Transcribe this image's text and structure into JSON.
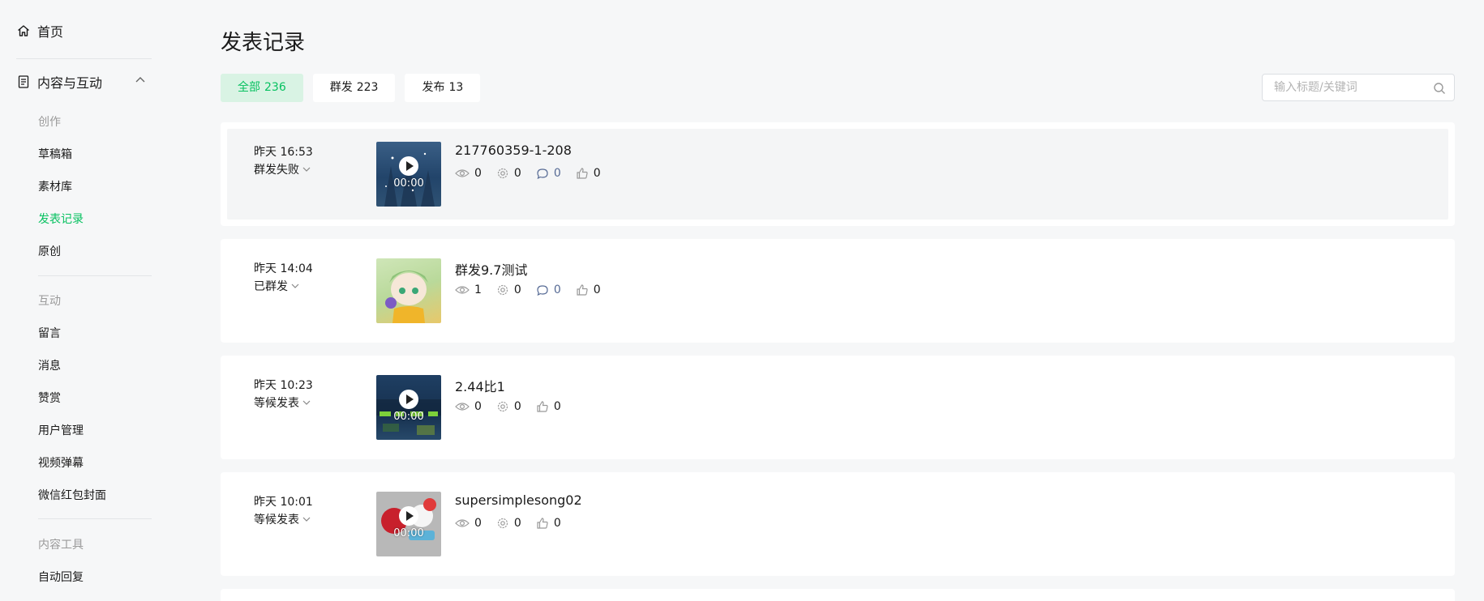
{
  "sidebar": {
    "home_label": "首页",
    "section_label": "内容与互动",
    "groups": [
      {
        "label": "创作",
        "items": [
          "草稿箱",
          "素材库",
          "发表记录",
          "原创"
        ]
      },
      {
        "label": "互动",
        "items": [
          "留言",
          "消息",
          "赞赏",
          "用户管理",
          "视频弹幕",
          "微信红包封面"
        ]
      },
      {
        "label": "内容工具",
        "items": [
          "自动回复"
        ]
      }
    ],
    "active_item": "发表记录"
  },
  "page": {
    "title": "发表记录",
    "tabs": [
      {
        "label": "全部",
        "count": "236"
      },
      {
        "label": "群发",
        "count": "223"
      },
      {
        "label": "发布",
        "count": "13"
      }
    ],
    "search_placeholder": "输入标题/关键词"
  },
  "records": [
    {
      "time": "昨天 16:53",
      "status": "群发失败",
      "title": "217760359-1-208",
      "duration": "00:00",
      "views": "0",
      "shares": "0",
      "comments": "0",
      "likes": "0",
      "has_comment": true,
      "thumb": "winter-forest"
    },
    {
      "time": "昨天 14:04",
      "status": "已群发",
      "title": "群发9.7测试",
      "duration": "",
      "views": "1",
      "shares": "0",
      "comments": "0",
      "likes": "0",
      "has_comment": true,
      "thumb": "anime-girl"
    },
    {
      "time": "昨天 10:23",
      "status": "等候发表",
      "title": "2.44比1",
      "duration": "00:00",
      "views": "0",
      "shares": "0",
      "comments": "",
      "likes": "0",
      "has_comment": false,
      "thumb": "game-scene"
    },
    {
      "time": "昨天 10:01",
      "status": "等候发表",
      "title": "supersimplesong02",
      "duration": "00:00",
      "views": "0",
      "shares": "0",
      "comments": "",
      "likes": "0",
      "has_comment": false,
      "thumb": "super-simple-songs"
    }
  ],
  "colors": {
    "accent": "#07c160",
    "accent_bg": "#d9f3e4",
    "comment": "#576b95",
    "page_bg": "#f6f7f8"
  }
}
